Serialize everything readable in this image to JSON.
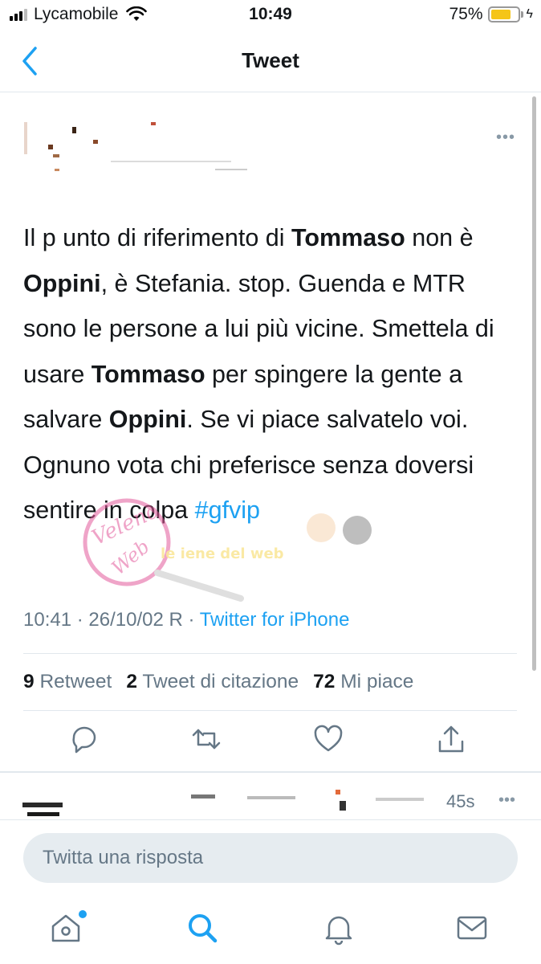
{
  "status_bar": {
    "carrier": "Lycamobile",
    "time": "10:49",
    "battery": "75%",
    "battery_level": 0.75
  },
  "nav": {
    "title": "Tweet",
    "back_icon": "chevron-left-icon"
  },
  "tweet": {
    "body": {
      "s1": "Il p",
      "s2": "unto di riferimento di ",
      "b1": "Tommaso",
      "s3": " non è ",
      "b2": "Oppini",
      "s4": ", è Stefania. stop. Guenda e MTR sono le persone a lui più vicine. Smettela di usare ",
      "b3": "Tommaso",
      "s5": " per spingere la gente a salvare ",
      "b4": "Oppini",
      "s6": ". Se vi piace salvatelo voi.  Ognuno vota chi preferisce senza doversi sentire in colpa ",
      "hashtag": "#gfvip"
    },
    "timestamp": "10:41 · 26/10/02 R · ",
    "source": "Twitter for iPhone",
    "stats": {
      "retweets_count": "9",
      "retweets_label": "Retweet",
      "quotes_count": "2",
      "quotes_label": "Tweet di citazione",
      "likes_count": "72",
      "likes_label": "Mi piace"
    },
    "more_icon": "more-horizontal-icon"
  },
  "reply_preview": {
    "time": "45s"
  },
  "reply_bar": {
    "placeholder": "Twitta una risposta"
  },
  "watermark": {
    "text": "Veleno Web",
    "subtext": "le iene del web"
  },
  "colors": {
    "accent": "#1da1f2",
    "text": "#14171a",
    "secondary": "#657786",
    "divider": "#e1e8ed",
    "battery": "#f5c518"
  }
}
